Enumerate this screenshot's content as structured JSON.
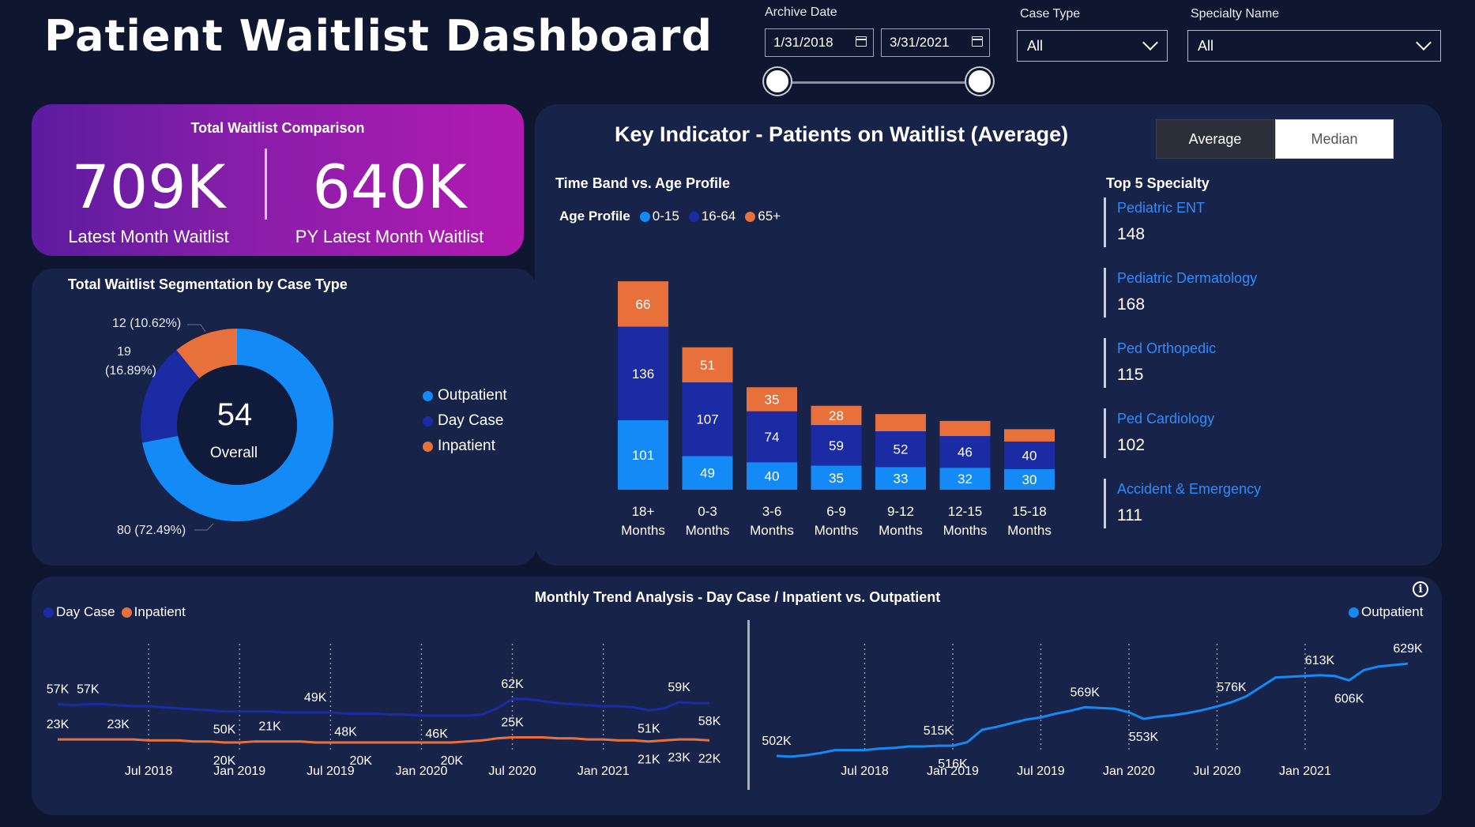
{
  "header": {
    "title": "Patient Waitlist Dashboard"
  },
  "filters": {
    "archive_date_label": "Archive Date",
    "start_date": "1/31/2018",
    "end_date": "3/31/2021",
    "case_type_label": "Case Type",
    "case_type_value": "All",
    "specialty_label": "Specialty Name",
    "specialty_value": "All"
  },
  "kpi": {
    "title": "Total Waitlist Comparison",
    "latest_value": "709K",
    "latest_label": "Latest Month Waitlist",
    "py_value": "640K",
    "py_label": "PY Latest Month Waitlist"
  },
  "segmentation": {
    "title": "Total Waitlist Segmentation by Case Type",
    "center_value": "54",
    "center_label": "Overall",
    "label_inpatient": "12 (10.62%)",
    "label_daycase_a": "19",
    "label_daycase_b": "(16.89%)",
    "label_outpatient": "80 (72.49%)",
    "legend": [
      "Outpatient",
      "Day Case",
      "Inpatient"
    ]
  },
  "key_indicator": {
    "title": "Key Indicator - Patients on Waitlist (Average)",
    "toggle_average": "Average",
    "toggle_median": "Median",
    "chart_title": "Time Band vs. Age Profile",
    "legend_title": "Age Profile",
    "legend": [
      "0-15",
      "16-64",
      "65+"
    ]
  },
  "top_specialty": {
    "title": "Top 5 Specialty",
    "items": [
      {
        "name": "Pediatric ENT",
        "value": "148"
      },
      {
        "name": "Pediatric Dermatology",
        "value": "168"
      },
      {
        "name": "Ped Orthopedic",
        "value": "115"
      },
      {
        "name": "Ped Cardiology",
        "value": "102"
      },
      {
        "name": "Accident & Emergency",
        "value": "111"
      }
    ]
  },
  "trend": {
    "title": "Monthly Trend Analysis - Day Case / Inpatient vs. Outpatient",
    "legend_left": [
      "Day Case",
      "Inpatient"
    ],
    "legend_right": "Outpatient",
    "info_icon": "info-icon"
  },
  "colors": {
    "bg": "#0f1730",
    "panel": "#18234a",
    "light_blue": "#138af5",
    "dark_blue": "#1a2ba3",
    "orange": "#e8703a",
    "spec_blue": "#2d8cff"
  },
  "chart_data": [
    {
      "type": "pie",
      "title": "Total Waitlist Segmentation by Case Type",
      "labels": [
        "Outpatient",
        "Day Case",
        "Inpatient"
      ],
      "values": [
        80,
        19,
        12
      ],
      "percent_labels": [
        "72.49%",
        "16.89%",
        "10.62%"
      ],
      "center_value": 54,
      "center_label": "Overall"
    },
    {
      "type": "bar",
      "stacked": true,
      "title": "Time Band vs. Age Profile",
      "categories": [
        "18+ Months",
        "0-3 Months",
        "3-6 Months",
        "6-9 Months",
        "9-12 Months",
        "12-15 Months",
        "15-18 Months"
      ],
      "series": [
        {
          "name": "0-15",
          "values": [
            101,
            49,
            40,
            35,
            33,
            32,
            30
          ],
          "labels": [
            "101",
            "49",
            "40",
            "35",
            "33",
            "32",
            "30"
          ]
        },
        {
          "name": "16-64",
          "values": [
            136,
            107,
            74,
            59,
            52,
            46,
            40
          ],
          "labels": [
            "136",
            "107",
            "74",
            "59",
            "52",
            "46",
            "40"
          ]
        },
        {
          "name": "65+",
          "values": [
            66,
            51,
            35,
            28,
            25,
            22,
            18
          ],
          "labels": [
            "66",
            "51",
            "35",
            "28",
            "",
            "",
            ""
          ]
        }
      ],
      "ylim": [
        0,
        310
      ]
    },
    {
      "type": "line",
      "title": "Monthly Trend Analysis - Day Case / Inpatient",
      "x_ticks": [
        "Jul 2018",
        "Jan 2019",
        "Jul 2019",
        "Jan 2020",
        "Jul 2020",
        "Jan 2021"
      ],
      "x_start": "2018-01",
      "x_end": "2021-03",
      "ylim": [
        0,
        75
      ],
      "series": [
        {
          "name": "Day Case",
          "values": [
            57,
            56,
            57,
            57,
            56,
            55,
            55,
            54,
            53,
            52,
            51,
            50,
            50,
            50,
            50,
            49,
            49,
            49,
            49,
            48,
            48,
            48,
            47,
            47,
            46,
            46,
            46,
            46,
            47,
            53,
            62,
            62,
            60,
            58,
            57,
            56,
            55,
            55,
            54,
            51,
            53,
            59,
            58,
            58
          ],
          "annotations": [
            [
              0,
              "57K"
            ],
            [
              2,
              "57K"
            ],
            [
              11,
              "50K"
            ],
            [
              17,
              "49K"
            ],
            [
              19,
              "48K"
            ],
            [
              25,
              "46K"
            ],
            [
              30,
              "62K"
            ],
            [
              39,
              "51K"
            ],
            [
              41,
              "59K"
            ],
            [
              43,
              "58K"
            ]
          ]
        },
        {
          "name": "Inpatient",
          "values": [
            23,
            23,
            23,
            23,
            23,
            23,
            22,
            22,
            22,
            21,
            21,
            20,
            20,
            21,
            21,
            21,
            21,
            20,
            20,
            20,
            20,
            20,
            20,
            20,
            20,
            20,
            20,
            21,
            22,
            24,
            25,
            25,
            25,
            24,
            24,
            23,
            23,
            22,
            22,
            21,
            22,
            23,
            23,
            22
          ],
          "annotations": [
            [
              0,
              "23K"
            ],
            [
              4,
              "23K"
            ],
            [
              11,
              "20K"
            ],
            [
              14,
              "21K"
            ],
            [
              20,
              "20K"
            ],
            [
              26,
              "20K"
            ],
            [
              30,
              "25K"
            ],
            [
              39,
              "21K"
            ],
            [
              41,
              "23K"
            ],
            [
              43,
              "22K"
            ]
          ]
        }
      ]
    },
    {
      "type": "line",
      "title": "Monthly Trend Analysis - Outpatient",
      "x_ticks": [
        "Jul 2018",
        "Jan 2019",
        "Jul 2019",
        "Jan 2020",
        "Jul 2020",
        "Jan 2021"
      ],
      "x_start": "2018-01",
      "x_end": "2021-03",
      "ylim": [
        470,
        650
      ],
      "series": [
        {
          "name": "Outpatient",
          "values": [
            502,
            501,
            503,
            506,
            510,
            510,
            510,
            512,
            513,
            515,
            515,
            516,
            516,
            521,
            538,
            542,
            547,
            552,
            555,
            560,
            564,
            569,
            568,
            567,
            562,
            553,
            556,
            558,
            561,
            565,
            570,
            576,
            584,
            597,
            610,
            611,
            612,
            613,
            612,
            606,
            620,
            625,
            627,
            629
          ],
          "annotations": [
            [
              0,
              "502K"
            ],
            [
              11,
              "515K"
            ],
            [
              12,
              "516K"
            ],
            [
              21,
              "569K"
            ],
            [
              25,
              "553K"
            ],
            [
              31,
              "576K"
            ],
            [
              37,
              "613K"
            ],
            [
              39,
              "606K"
            ],
            [
              43,
              "629K"
            ]
          ]
        }
      ]
    }
  ]
}
